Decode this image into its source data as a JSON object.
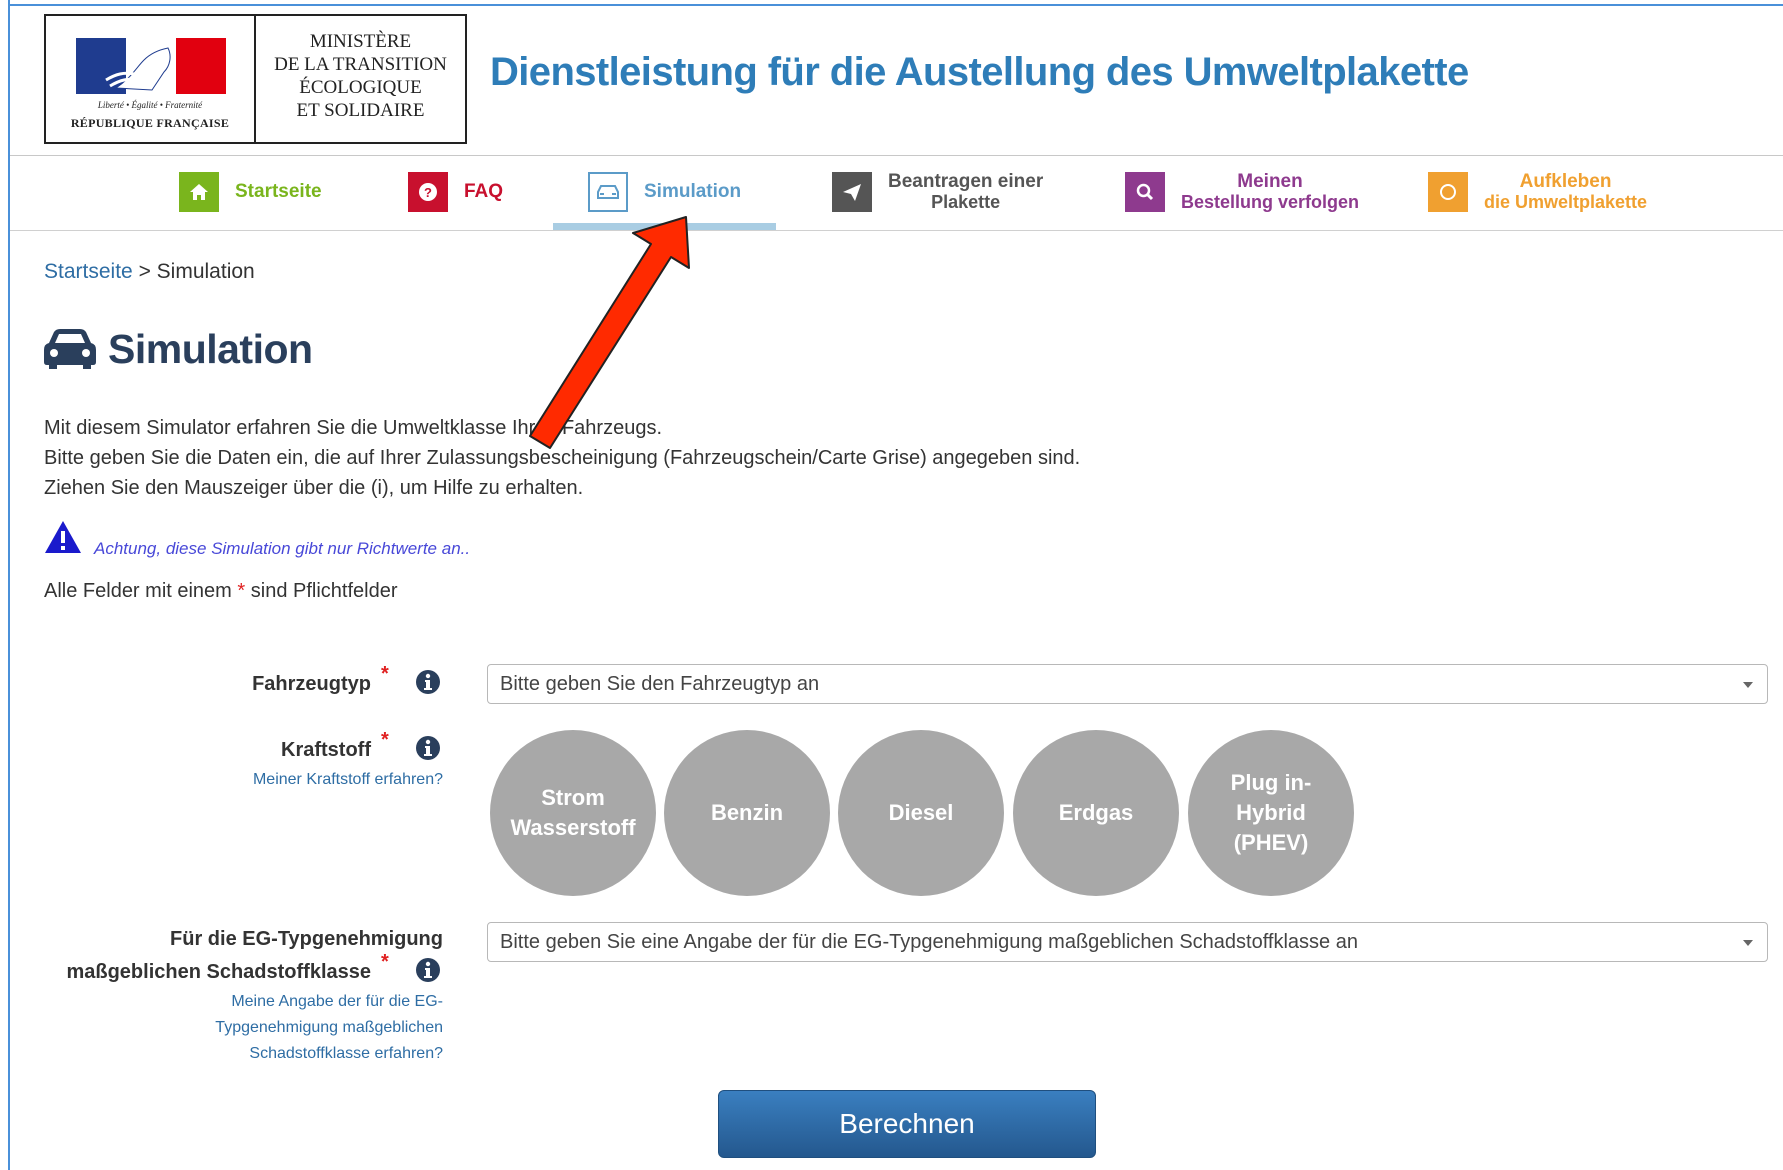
{
  "header": {
    "ministry_lines": [
      "MINISTÈRE",
      "DE LA TRANSITION",
      "ÉCOLOGIQUE",
      "ET SOLIDAIRE"
    ],
    "motto": "Liberté • Égalité • Fraternité",
    "republique": "RÉPUBLIQUE FRANÇAISE",
    "site_title": "Dienstleistung für die Austellung des Umweltplakette"
  },
  "nav": {
    "items": [
      {
        "label": "Startseite",
        "icon": "home-icon",
        "color": "#7ab51d"
      },
      {
        "label": "FAQ",
        "icon": "question-icon",
        "color": "#c8102e"
      },
      {
        "label": "Simulation",
        "icon": "car-icon",
        "color": "#5b9bc8",
        "active": true
      },
      {
        "label": "Beantragen einer",
        "label2": "Plakette",
        "icon": "paper-plane-icon",
        "color": "#555555"
      },
      {
        "label": "Meinen",
        "label2": "Bestellung verfolgen",
        "icon": "search-icon",
        "color": "#8e3a8e"
      },
      {
        "label": "Aufkleben",
        "label2": "die Umweltplakette",
        "icon": "circle-icon",
        "color": "#f0a030"
      }
    ]
  },
  "breadcrumb": {
    "home": "Startseite",
    "separator": ">",
    "current": "Simulation"
  },
  "page_title": "Simulation",
  "intro": [
    "Mit diesem Simulator erfahren Sie die Umweltklasse Ihres Fahrzeugs.",
    "Bitte geben Sie die Daten ein, die auf Ihrer Zulassungsbescheinigung (Fahrzeugschein/Carte Grise) angegeben sind.",
    "Ziehen Sie den Mauszeiger über die (i), um Hilfe zu erhalten."
  ],
  "warning": "Achtung, diese Simulation gibt nur Richtwerte an..",
  "required_note": {
    "before": "Alle Felder mit einem",
    "star": "*",
    "after": "sind Pflichtfelder"
  },
  "form": {
    "vehicle_type": {
      "label": "Fahrzeugtyp",
      "placeholder": "Bitte geben Sie den Fahrzeugtyp an"
    },
    "fuel": {
      "label": "Kraftstoff",
      "help": "Meiner Kraftstoff erfahren?",
      "options": [
        {
          "line1": "Strom",
          "line2": "Wasserstoff"
        },
        {
          "line1": "Benzin"
        },
        {
          "line1": "Diesel"
        },
        {
          "line1": "Erdgas"
        },
        {
          "line1": "Plug in-",
          "line2": "Hybrid",
          "line3": "(PHEV)"
        }
      ]
    },
    "emission_class": {
      "label_line1": "Für die EG-Typgenehmigung",
      "label_line2": "maßgeblichen Schadstoffklasse",
      "help_lines": [
        "Meine Angabe der für die EG-",
        "Typgenehmigung maßgeblichen",
        "Schadstoffklasse erfahren?"
      ],
      "placeholder": "Bitte geben Sie eine Angabe der für die EG-Typgenehmigung maßgeblichen Schadstoffklasse an"
    },
    "submit_label": "Berechnen"
  },
  "colors": {
    "accent": "#2e7db8",
    "title": "#2a3f5c",
    "annotation_arrow": "#ff2a00",
    "fuel_button": "#a8a8a8"
  }
}
